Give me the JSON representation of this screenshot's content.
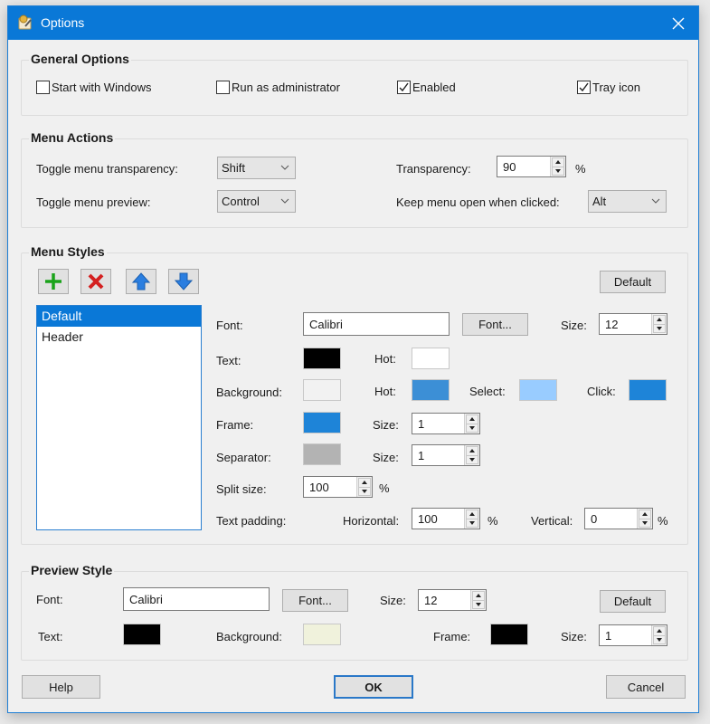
{
  "window": {
    "title": "Options",
    "icon": "options-app-icon",
    "close_icon": "close-icon"
  },
  "general_options": {
    "title": "General Options",
    "checkboxes": [
      {
        "label": "Start with Windows",
        "checked": false
      },
      {
        "label": "Run as administrator",
        "checked": false
      },
      {
        "label": "Enabled",
        "checked": true
      },
      {
        "label": "Tray icon",
        "checked": true
      }
    ]
  },
  "menu_actions": {
    "title": "Menu Actions",
    "toggle_transparency_label": "Toggle menu transparency:",
    "toggle_transparency_value": "Shift",
    "toggle_preview_label": "Toggle menu preview:",
    "toggle_preview_value": "Control",
    "transparency_label": "Transparency:",
    "transparency_value": "90",
    "transparency_unit": "%",
    "keep_open_label": "Keep menu open when clicked:",
    "keep_open_value": "Alt"
  },
  "menu_styles": {
    "title": "Menu Styles",
    "toolbar": {
      "add_icon": "plus-icon",
      "delete_icon": "delete-x-icon",
      "up_icon": "arrow-up-icon",
      "down_icon": "arrow-down-icon"
    },
    "default_button": "Default",
    "styles_list": [
      {
        "label": "Default",
        "selected": true
      },
      {
        "label": "Header",
        "selected": false
      }
    ],
    "font_label": "Font:",
    "font_value": "Calibri",
    "font_button": "Font...",
    "size_label": "Size:",
    "size_value": "12",
    "text_label": "Text:",
    "text_color": "#000000",
    "hot_label": "Hot:",
    "text_hot_color": "#ffffff",
    "background_label": "Background:",
    "background_color": "#f2f2f2",
    "background_hot_color": "#3c8fd6",
    "select_label": "Select:",
    "select_color": "#99ccff",
    "click_label": "Click:",
    "click_color": "#1e84d8",
    "frame_label": "Frame:",
    "frame_color": "#1e84d8",
    "frame_size_label": "Size:",
    "frame_size_value": "1",
    "separator_label": "Separator:",
    "separator_color": "#b3b3b3",
    "separator_size_label": "Size:",
    "separator_size_value": "1",
    "split_size_label": "Split size:",
    "split_size_value": "100",
    "split_size_unit": "%",
    "text_padding_label": "Text padding:",
    "horizontal_label": "Horizontal:",
    "horizontal_value": "100",
    "horizontal_unit": "%",
    "vertical_label": "Vertical:",
    "vertical_value": "0",
    "vertical_unit": "%"
  },
  "preview_style": {
    "title": "Preview Style",
    "font_label": "Font:",
    "font_value": "Calibri",
    "font_button": "Font...",
    "size_label": "Size:",
    "size_value": "12",
    "default_button": "Default",
    "text_label": "Text:",
    "text_color": "#000000",
    "background_label": "Background:",
    "background_color": "#f0f2dc",
    "frame_label": "Frame:",
    "frame_color": "#000000",
    "frame_size_label": "Size:",
    "frame_size_value": "1"
  },
  "footer": {
    "help": "Help",
    "ok": "OK",
    "cancel": "Cancel"
  }
}
